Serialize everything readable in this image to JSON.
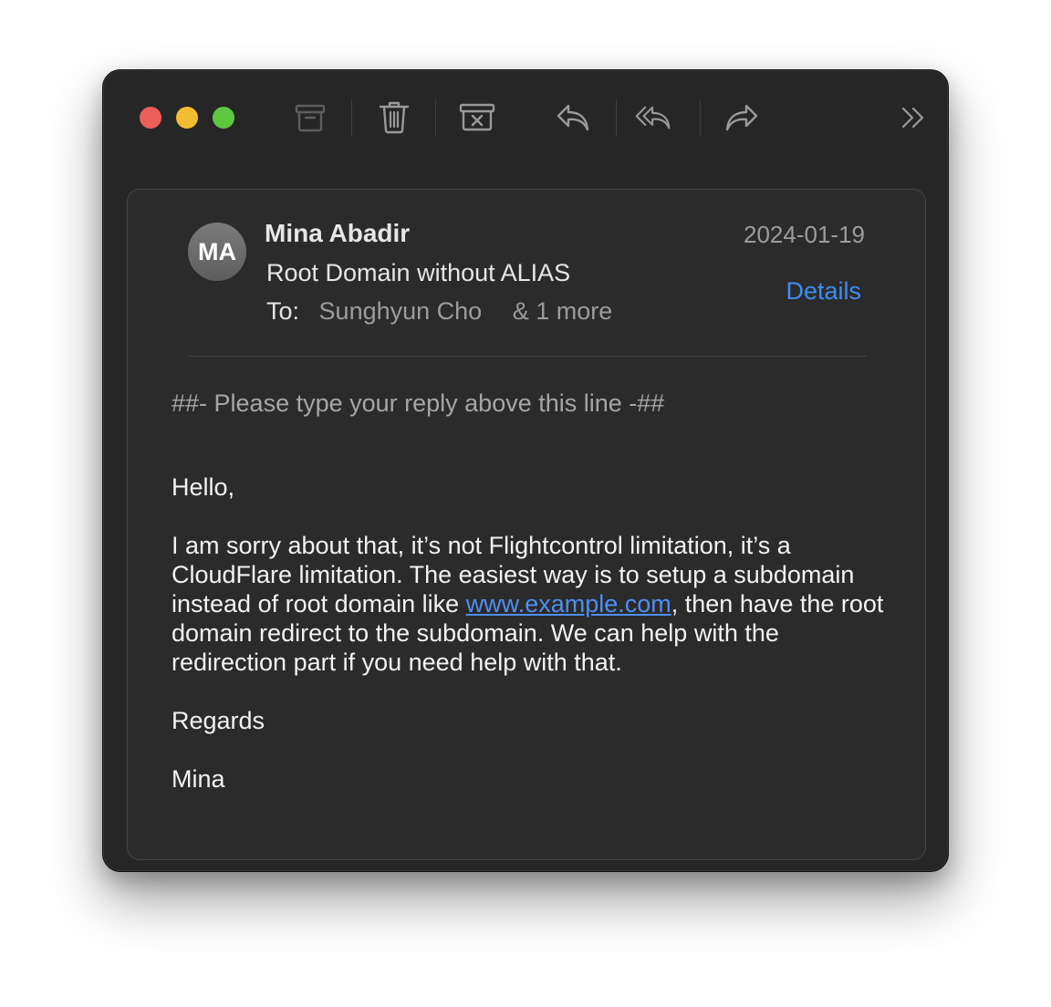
{
  "toolbar": {
    "icons": [
      "archive-icon",
      "trash-icon",
      "junk-icon",
      "reply-icon",
      "reply-all-icon",
      "forward-icon",
      "more-chevrons-icon"
    ]
  },
  "message": {
    "avatar_initials": "MA",
    "sender": "Mina Abadir",
    "date": "2024-01-19",
    "subject": "Root Domain without ALIAS",
    "to_label": "To:",
    "to_name": "Sunghyun Cho",
    "to_more": "& 1 more",
    "details_label": "Details",
    "details_color": "#3d8df5"
  },
  "body": {
    "reply_line": "##- Please type your reply above this line -##",
    "greeting": "Hello,",
    "para_before_link": "I am sorry about that, it’s not Flightcontrol limitation, it’s a CloudFlare limitation. The easiest way is to setup a subdomain instead of root domain like ",
    "link_text": "www.example.com",
    "para_after_link": ", then have the root domain redirect to the subdomain. We can help with the redirection part if you need help with that.",
    "regards": "Regards",
    "signature": "Mina"
  }
}
